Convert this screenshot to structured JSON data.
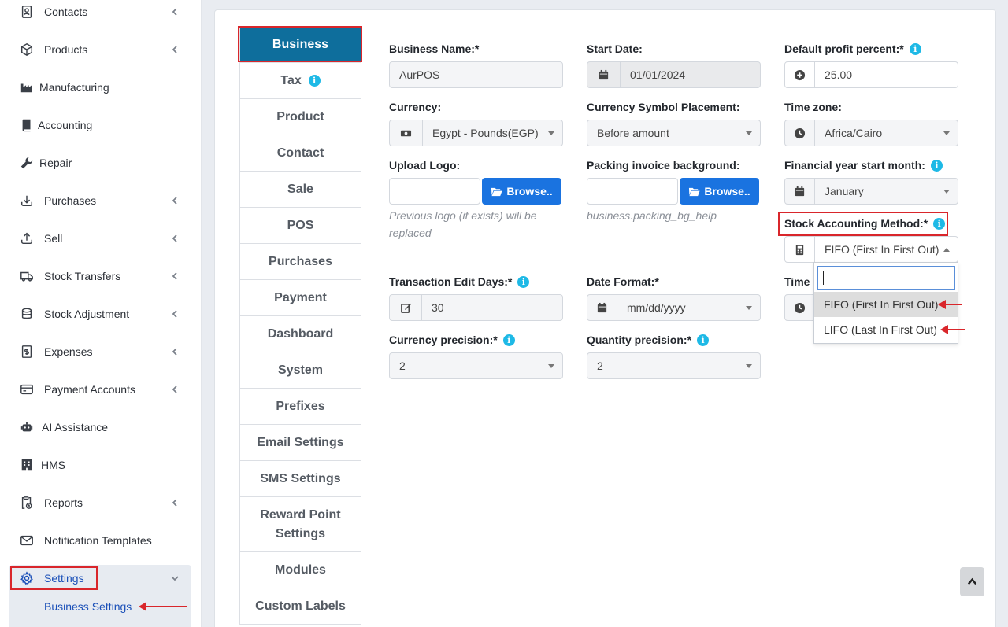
{
  "sidebar": {
    "items": [
      {
        "label": "Contacts",
        "icon": "contacts-icon",
        "chevron": true
      },
      {
        "label": "Products",
        "icon": "box-icon",
        "chevron": true
      },
      {
        "label": "Manufacturing",
        "icon": "industry-icon",
        "chevron": false
      },
      {
        "label": "Accounting",
        "icon": "book-icon",
        "chevron": false
      },
      {
        "label": "Repair",
        "icon": "wrench-icon",
        "chevron": false
      },
      {
        "label": "Purchases",
        "icon": "download-icon",
        "chevron": true
      },
      {
        "label": "Sell",
        "icon": "upload-icon",
        "chevron": true
      },
      {
        "label": "Stock Transfers",
        "icon": "truck-icon",
        "chevron": true
      },
      {
        "label": "Stock Adjustment",
        "icon": "database-icon",
        "chevron": true
      },
      {
        "label": "Expenses",
        "icon": "receipt-icon",
        "chevron": true
      },
      {
        "label": "Payment Accounts",
        "icon": "credit-card-icon",
        "chevron": true
      },
      {
        "label": "AI Assistance",
        "icon": "robot-icon",
        "chevron": false
      },
      {
        "label": "HMS",
        "icon": "hotel-icon",
        "chevron": false
      },
      {
        "label": "Reports",
        "icon": "report-icon",
        "chevron": true
      },
      {
        "label": "Notification Templates",
        "icon": "envelope-icon",
        "chevron": false
      }
    ],
    "settings_label": "Settings",
    "business_settings_label": "Business Settings"
  },
  "tabs": [
    {
      "label": "Business"
    },
    {
      "label": "Tax"
    },
    {
      "label": "Product"
    },
    {
      "label": "Contact"
    },
    {
      "label": "Sale"
    },
    {
      "label": "POS"
    },
    {
      "label": "Purchases"
    },
    {
      "label": "Payment"
    },
    {
      "label": "Dashboard"
    },
    {
      "label": "System"
    },
    {
      "label": "Prefixes"
    },
    {
      "label": "Email Settings"
    },
    {
      "label": "SMS Settings"
    },
    {
      "label": "Reward Point Settings"
    },
    {
      "label": "Modules"
    },
    {
      "label": "Custom Labels"
    }
  ],
  "form": {
    "business_name": {
      "label": "Business Name:*",
      "value": "AurPOS"
    },
    "start_date": {
      "label": "Start Date:",
      "value": "01/01/2024"
    },
    "profit_percent": {
      "label": "Default profit percent:*",
      "value": "25.00"
    },
    "currency": {
      "label": "Currency:",
      "value": "Egypt - Pounds(EGP)"
    },
    "symbol_placement": {
      "label": "Currency Symbol Placement:",
      "value": "Before amount"
    },
    "time_zone": {
      "label": "Time zone:",
      "value": "Africa/Cairo"
    },
    "upload_logo": {
      "label": "Upload Logo:",
      "button": "Browse..",
      "help": "Previous logo (if exists) will be replaced"
    },
    "packing_bg": {
      "label": "Packing invoice background:",
      "button": "Browse..",
      "help": "business.packing_bg_help"
    },
    "fy_start_month": {
      "label": "Financial year start month:",
      "value": "January"
    },
    "stock_method": {
      "label": "Stock Accounting Method:*",
      "value": "FIFO (First In First Out)"
    },
    "edit_days": {
      "label": "Transaction Edit Days:*",
      "value": "30"
    },
    "date_format": {
      "label": "Date Format:*",
      "value": "mm/dd/yyyy"
    },
    "time_format": {
      "label": "Time"
    },
    "currency_precision": {
      "label": "Currency precision:*",
      "value": "2"
    },
    "quantity_precision": {
      "label": "Quantity precision:*",
      "value": "2"
    }
  },
  "dropdown": {
    "search_value": "",
    "options": [
      {
        "label": "FIFO (First In First Out)",
        "selected": true
      },
      {
        "label": "LIFO (Last In First Out)",
        "selected": false
      }
    ]
  },
  "colors": {
    "accent": "#0e6e9c",
    "annotation": "#d9262b",
    "info": "#1eb9e6",
    "button": "#1a73e0"
  }
}
